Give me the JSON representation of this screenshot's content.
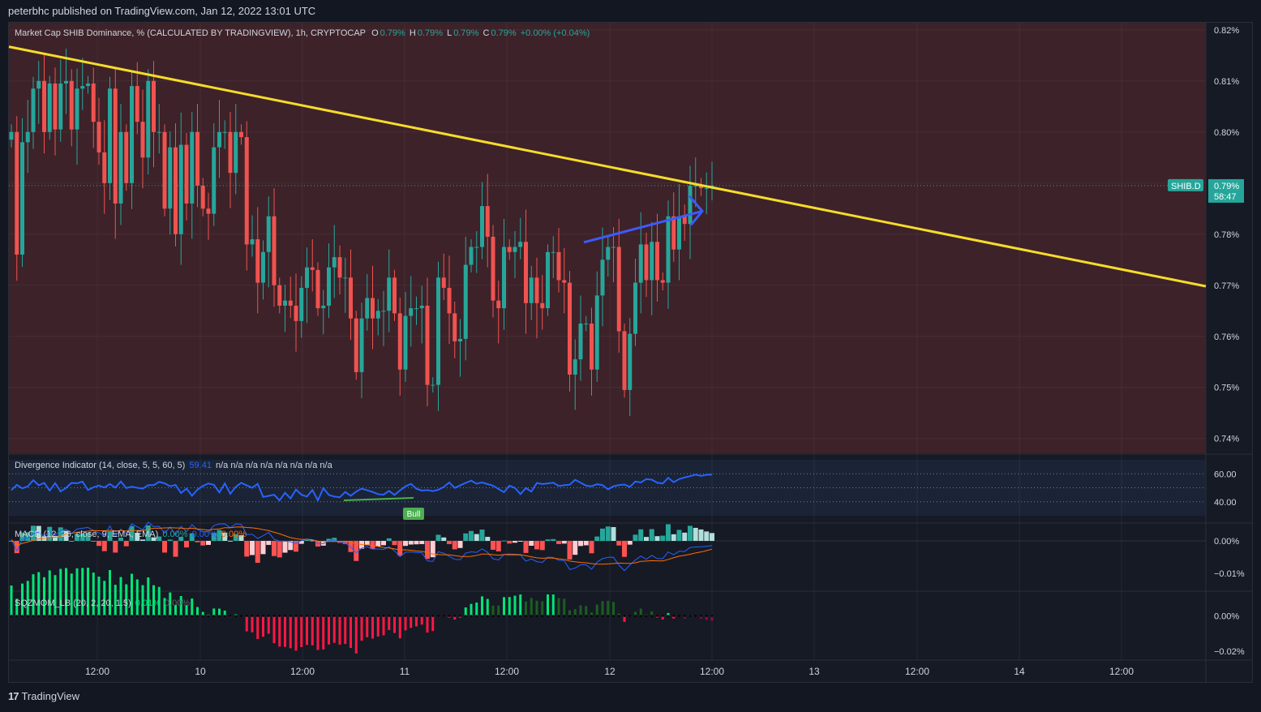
{
  "header": {
    "published": "peterbhc published on TradingView.com, Jan 12, 2022 13:01 UTC"
  },
  "footer": {
    "brand": "TradingView"
  },
  "colors": {
    "up": "#26a69a",
    "down": "#ef5350",
    "trendline": "#f5dc2a",
    "arrow": "#3d5afe",
    "bg_panel": "#3d2229",
    "divergence": "#2962ff",
    "macd_line": "#2962ff",
    "signal_line": "#ff6d00"
  },
  "main_legend": {
    "name": "Market Cap SHIB Dominance, % (CALCULATED BY TRADINGVIEW), 1h, CRYPTOCAP",
    "o_label": "O",
    "o": "0.79%",
    "h_label": "H",
    "h": "0.79%",
    "l_label": "L",
    "l": "0.79%",
    "c_label": "C",
    "c": "0.79%",
    "change": "+0.00% (+0.04%)"
  },
  "price_tag": {
    "symbol": "SHIB.D",
    "value": "0.79%",
    "countdown": "58:47"
  },
  "div_legend": {
    "name": "Divergence Indicator (14, close, 5, 5, 60, 5)",
    "value": "59.41",
    "na": "n/a n/a n/a n/a n/a n/a n/a n/a",
    "bull_label": "Bull"
  },
  "macd_legend": {
    "name": "MACD (12, 26, close, 9, EMA, EMA)",
    "v1": "0.00%",
    "v2": "0.00%",
    "v3": "0.00%"
  },
  "sqz_legend": {
    "name": "SQZMOM_LB (20, 2, 20, 1.5)",
    "v1": "0.01%",
    "v2": "0.00%"
  },
  "chart_data": [
    {
      "type": "candlestick",
      "title": "Market Cap SHIB Dominance, % (CALCULATED BY TRADINGVIEW), 1h, CRYPTOCAP",
      "y_ticks": [
        "0.82%",
        "0.81%",
        "0.80%",
        "0.79%",
        "0.78%",
        "0.77%",
        "0.76%",
        "0.75%",
        "0.74%"
      ],
      "x_ticks": [
        "12:00",
        "10",
        "12:00",
        "11",
        "12:00",
        "12",
        "12:00",
        "13",
        "12:00",
        "14",
        "12:00"
      ],
      "ylim": [
        0.7371,
        0.8214
      ],
      "series_close": [
        0.8,
        0.776,
        0.798,
        0.8,
        0.8085,
        0.81,
        0.8,
        0.8095,
        0.8005,
        0.8095,
        0.81,
        0.8005,
        0.8085,
        0.809,
        0.8095,
        0.802,
        0.796,
        0.79,
        0.8085,
        0.786,
        0.8,
        0.79,
        0.809,
        0.802,
        0.795,
        0.81,
        0.8,
        0.8,
        0.785,
        0.797,
        0.78,
        0.7975,
        0.786,
        0.8,
        0.7895,
        0.785,
        0.784,
        0.797,
        0.8,
        0.8,
        0.792,
        0.8,
        0.799,
        0.778,
        0.779,
        0.7705,
        0.7765,
        0.7835,
        0.77,
        0.766,
        0.767,
        0.766,
        0.763,
        0.7695,
        0.7735,
        0.773,
        0.7655,
        0.766,
        0.7735,
        0.7755,
        0.7715,
        0.7715,
        0.7635,
        0.753,
        0.7635,
        0.7675,
        0.7635,
        0.765,
        0.765,
        0.7715,
        0.7645,
        0.7535,
        0.764,
        0.7655,
        0.7655,
        0.766,
        0.7505,
        0.7505,
        0.7715,
        0.7695,
        0.7645,
        0.759,
        0.7595,
        0.774,
        0.7775,
        0.7775,
        0.7855,
        0.7795,
        0.767,
        0.7655,
        0.7775,
        0.7765,
        0.7775,
        0.7785,
        0.7665,
        0.7715,
        0.7665,
        0.7655,
        0.7765,
        0.7765,
        0.771,
        0.7705,
        0.7525,
        0.7555,
        0.7625,
        0.7625,
        0.7535,
        0.768,
        0.775,
        0.7775,
        0.7775,
        0.761,
        0.7495,
        0.7605,
        0.7705,
        0.778,
        0.771,
        0.7785,
        0.771,
        0.7705,
        0.7835,
        0.777,
        0.7835,
        0.782,
        0.7895,
        0.7895,
        0.789,
        0.789,
        0.7895
      ],
      "note_trendline": "descending yellow trendline from 0.8167 (left) to 0.7698 (right)"
    },
    {
      "type": "line",
      "title": "Divergence Indicator (14, close, 5, 5, 60, 5)",
      "y_ticks": [
        "60.00",
        "40.00"
      ],
      "ylim": [
        30,
        70
      ],
      "values": [
        48.3,
        52.1,
        49.6,
        51.0,
        55.4,
        51.8,
        53.5,
        48.0,
        53.3,
        47.4,
        49.9,
        53.5,
        53.2,
        54.4,
        48.4,
        50.3,
        51.6,
        50.2,
        52.7,
        50.1,
        54.5,
        49.8,
        50.8,
        50.0,
        49.4,
        51.9,
        51.9,
        54.2,
        53.2,
        51.1,
        52.0,
        46.3,
        49.4,
        44.3,
        48.7,
        51.3,
        53.1,
        52.1,
        46.7,
        53.1,
        45.7,
        50.7,
        53.5,
        51.7,
        50.0,
        52.8,
        43.5,
        44.2,
        45.0,
        41.0,
        46.4,
        42.4,
        48.7,
        45.0,
        43.7,
        48.4,
        41.0,
        49.7,
        44.9,
        43.7,
        43.2,
        47.0,
        44.3,
        47.3,
        49.4,
        48.2,
        47.0,
        45.4,
        45.1,
        47.8,
        44.9,
        48.1,
        51.0,
        52.8,
        49.3,
        48.0,
        48.3,
        47.6,
        48.6,
        50.6,
        53.8,
        49.9,
        51.7,
        53.5,
        55.1,
        52.9,
        53.8,
        52.6,
        51.5,
        49.1,
        46.9,
        51.5,
        49.9,
        45.5,
        49.8,
        47.3,
        53.4,
        52.7,
        53.1,
        53.6,
        51.3,
        51.8,
        52.2,
        55.7,
        53.6,
        51.5,
        51.1,
        52.5,
        51.9,
        48.9,
        51.1,
        51.9,
        52.3,
        50.6,
        54.5,
        53.8,
        56.2,
        55.8,
        53.6,
        53.1,
        57.1,
        54.0,
        56.2,
        57.4,
        58.3,
        59.4,
        58.5,
        59.3,
        59.4
      ],
      "annotation": "Bull"
    },
    {
      "type": "bar+line",
      "title": "MACD (12, 26, close, 9, EMA, EMA)",
      "y_ticks": [
        "0.00%",
        "−0.01%"
      ],
      "ylim": [
        -0.0155,
        0.0055
      ]
    },
    {
      "type": "bar",
      "title": "SQZMOM_LB (20, 2, 20, 1.5)",
      "y_ticks": [
        "0.00%",
        "−0.02%"
      ],
      "ylim": [
        -0.025,
        0.014
      ]
    }
  ]
}
